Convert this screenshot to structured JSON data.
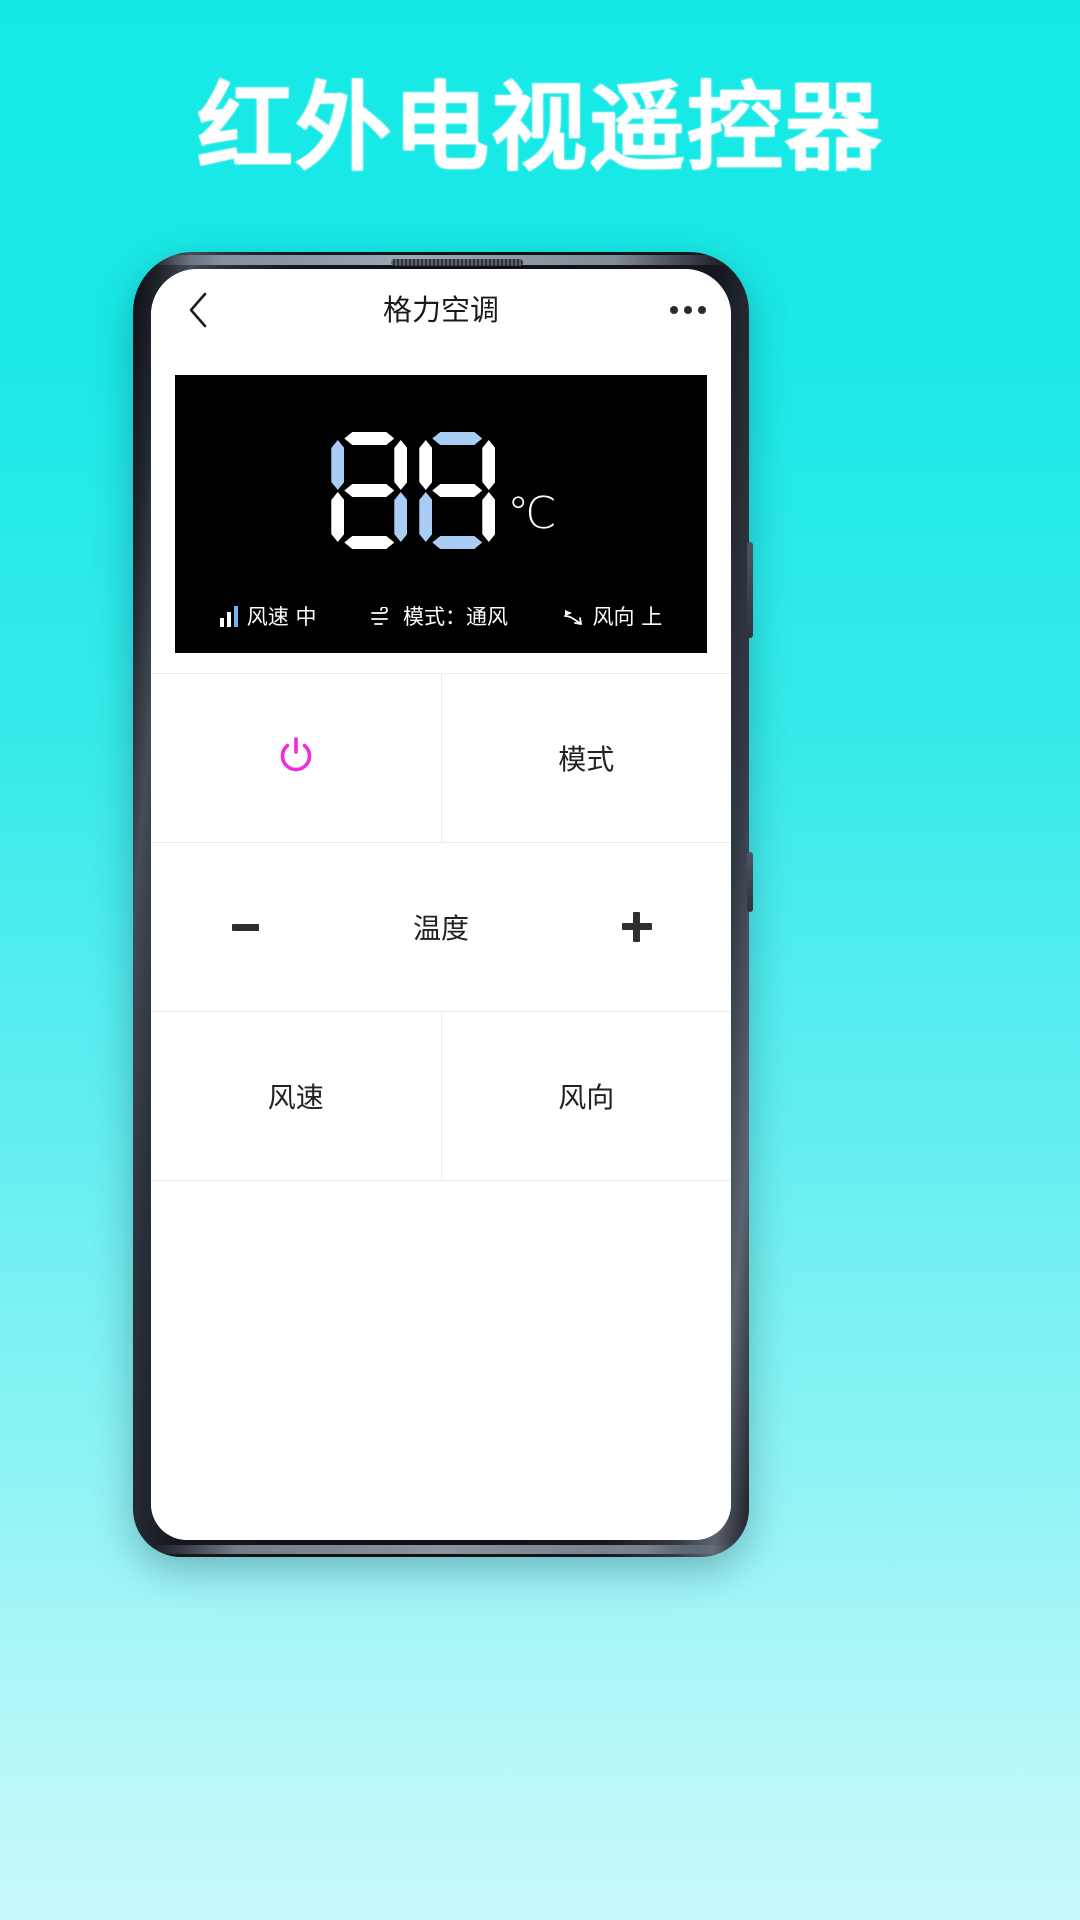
{
  "headline": "红外电视遥控器",
  "theme": {
    "background_top": "#15e9e6",
    "background_bottom": "#c9f9fa",
    "headline_color": "#ffffff",
    "power_accent": "#f02ae0",
    "lcd_background": "#000000",
    "segment_on": "#ffffff",
    "segment_dim": "#a9cdf4",
    "divider": "#ebebeb"
  },
  "app": {
    "titlebar": {
      "back_icon": "chevron-left-icon",
      "title": "格力空调",
      "more_icon": "more-horizontal-icon"
    },
    "display": {
      "temperature": "88",
      "unit": "℃",
      "digit_segments": [
        {
          "a": "on",
          "b": "on",
          "c": "on",
          "d": "on",
          "e": "on",
          "f": "dim",
          "g": "on"
        },
        {
          "a": "dim",
          "b": "on",
          "c": "on",
          "d": "dim",
          "e": "dim",
          "f": "on",
          "g": "on"
        }
      ],
      "status": [
        {
          "icon": "fan-speed-bars-icon",
          "label": "风速 中"
        },
        {
          "icon": "mode-wind-icon",
          "label": "模式：通风"
        },
        {
          "icon": "wind-direction-icon",
          "label": "风向 上"
        }
      ]
    },
    "controls": {
      "power_label": "",
      "power_icon": "power-icon",
      "mode_label": "模式",
      "temp_minus": "−",
      "temp_label": "温度",
      "temp_plus": "+",
      "fan_speed_label": "风速",
      "wind_direction_label": "风向"
    }
  }
}
